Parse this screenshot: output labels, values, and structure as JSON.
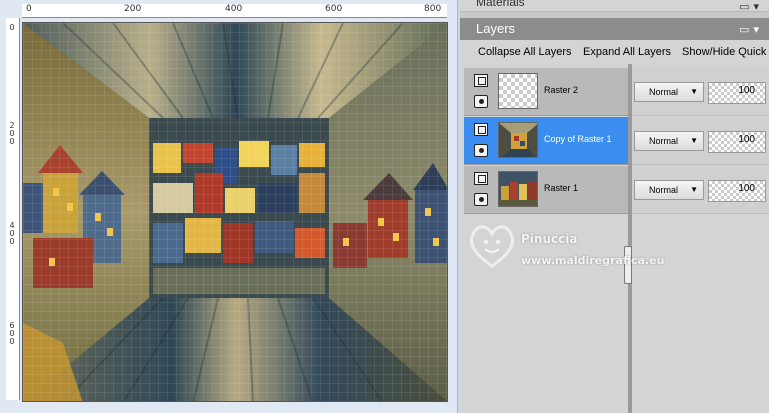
{
  "ruler": {
    "h_labels": [
      "0",
      "200",
      "400",
      "600",
      "800"
    ],
    "v_labels": [
      "0",
      "200",
      "400",
      "600"
    ]
  },
  "panels": {
    "materials_title": "Materials",
    "layers_title": "Layers"
  },
  "toolbar": {
    "collapse_all": "Collapse All Layers",
    "expand_all": "Expand All Layers",
    "show_hide": "Show/Hide Quick"
  },
  "layers": [
    {
      "name": "Raster 2",
      "blend_mode": "Normal",
      "opacity": "100",
      "selected": false
    },
    {
      "name": "Copy of Raster 1",
      "blend_mode": "Normal",
      "opacity": "100",
      "selected": true
    },
    {
      "name": "Raster 1",
      "blend_mode": "Normal",
      "opacity": "100",
      "selected": false
    }
  ],
  "watermark": {
    "name": "Pinuccia",
    "url": "www.maldiregrafica.eu"
  },
  "colors": {
    "selected_row": "#3b8ef0",
    "panel_header": "#8c8c8c",
    "panel_bg": "#d4d4d4"
  },
  "icons": [
    "layer-group-icon",
    "visibility-eye-icon",
    "dropdown-chevron-icon",
    "minimize-icon",
    "menu-icon"
  ]
}
